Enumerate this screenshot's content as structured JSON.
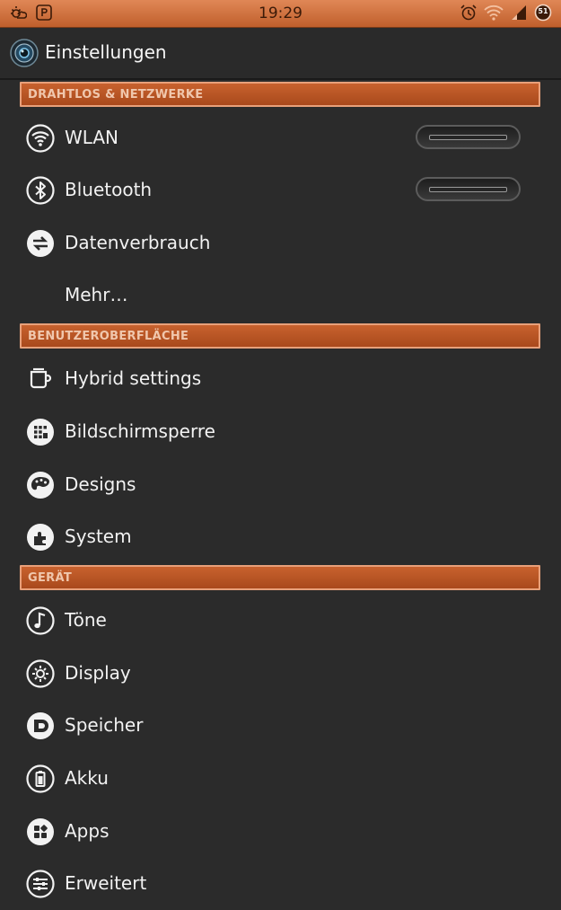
{
  "statusbar": {
    "time": "19:29",
    "battery_level": "51",
    "icons": [
      "weather-icon",
      "parking-p-icon",
      "alarm-icon",
      "wifi-signal-icon",
      "cell-signal-icon",
      "battery-icon"
    ]
  },
  "actionbar": {
    "title": "Einstellungen",
    "icon": "settings-app-icon"
  },
  "sections": {
    "wireless": "DRAHTLOS & NETZWERKE",
    "ui": "BENUTZEROBERFLÄCHE",
    "device": "GERÄT"
  },
  "items": {
    "wlan": {
      "label": "WLAN",
      "icon": "wifi-icon",
      "toggle": "off"
    },
    "bluetooth": {
      "label": "Bluetooth",
      "icon": "bluetooth-icon",
      "toggle": "off"
    },
    "data_usage": {
      "label": "Datenverbrauch",
      "icon": "data-usage-icon"
    },
    "more": {
      "label": "Mehr…"
    },
    "hybrid": {
      "label": "Hybrid settings",
      "icon": "hybrid-icon"
    },
    "lockscreen": {
      "label": "Bildschirmsperre",
      "icon": "lockscreen-icon"
    },
    "designs": {
      "label": "Designs",
      "icon": "palette-icon"
    },
    "system": {
      "label": "System",
      "icon": "puzzle-icon"
    },
    "sound": {
      "label": "Töne",
      "icon": "music-note-icon"
    },
    "display": {
      "label": "Display",
      "icon": "brightness-icon"
    },
    "storage": {
      "label": "Speicher",
      "icon": "storage-icon"
    },
    "battery": {
      "label": "Akku",
      "icon": "battery-icon"
    },
    "apps": {
      "label": "Apps",
      "icon": "apps-icon"
    },
    "advanced": {
      "label": "Erweitert",
      "icon": "sliders-icon"
    }
  },
  "colors": {
    "accent": "#c05f2c",
    "background": "#2b2b2b"
  }
}
